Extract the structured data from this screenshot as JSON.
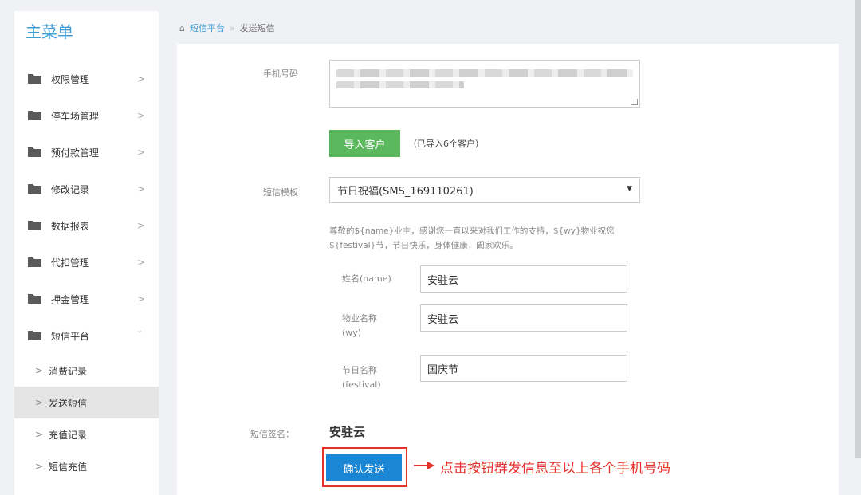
{
  "sidebar": {
    "title": "主菜单",
    "items": [
      {
        "label": "权限管理",
        "arrow": ">"
      },
      {
        "label": "停车场管理",
        "arrow": ">"
      },
      {
        "label": "预付款管理",
        "arrow": ">"
      },
      {
        "label": "修改记录",
        "arrow": ">"
      },
      {
        "label": "数据报表",
        "arrow": ">"
      },
      {
        "label": "代扣管理",
        "arrow": ">"
      },
      {
        "label": "押金管理",
        "arrow": ">"
      },
      {
        "label": "短信平台",
        "arrow": "ˇ"
      }
    ],
    "sub_items": [
      {
        "label": "消费记录",
        "chevron": ">"
      },
      {
        "label": "发送短信",
        "chevron": ">"
      },
      {
        "label": "充值记录",
        "chevron": ">"
      },
      {
        "label": "短信充值",
        "chevron": ">"
      }
    ],
    "active_sub_item": "发送短信",
    "folder_color": "#5a5a5a"
  },
  "breadcrumb": {
    "home": "短信平台",
    "separator": "»",
    "current": "发送短信"
  },
  "form": {
    "phone_label": "手机号码",
    "import_button": "导入客户",
    "import_note": "（已导入6个客户）",
    "template_label": "短信模板",
    "template_selected": "节日祝福(SMS_169110261)",
    "template_text": "尊敬的${name}业主，感谢您一直以来对我们工作的支持，${wy}物业祝您${festival}节，节日快乐，身体健康，阖家欢乐。",
    "params": [
      {
        "label_line1": "姓名(name)",
        "label_line2": "",
        "value": "安驻云"
      },
      {
        "label_line1": "物业名称",
        "label_line2": "(wy)",
        "value": "安驻云"
      },
      {
        "label_line1": "节日名称",
        "label_line2": "(festival)",
        "value": "国庆节"
      }
    ],
    "sign_label": "短信签名：",
    "sign_value": "安驻云",
    "confirm_button": "确认发送",
    "annotation": "点击按钮群发信息至以上各个手机号码"
  },
  "colors": {
    "brand_blue": "#3d9bd6",
    "import_green": "#5cb85c",
    "confirm_blue": "#1b86d3",
    "annotation_red": "#e5322d"
  }
}
